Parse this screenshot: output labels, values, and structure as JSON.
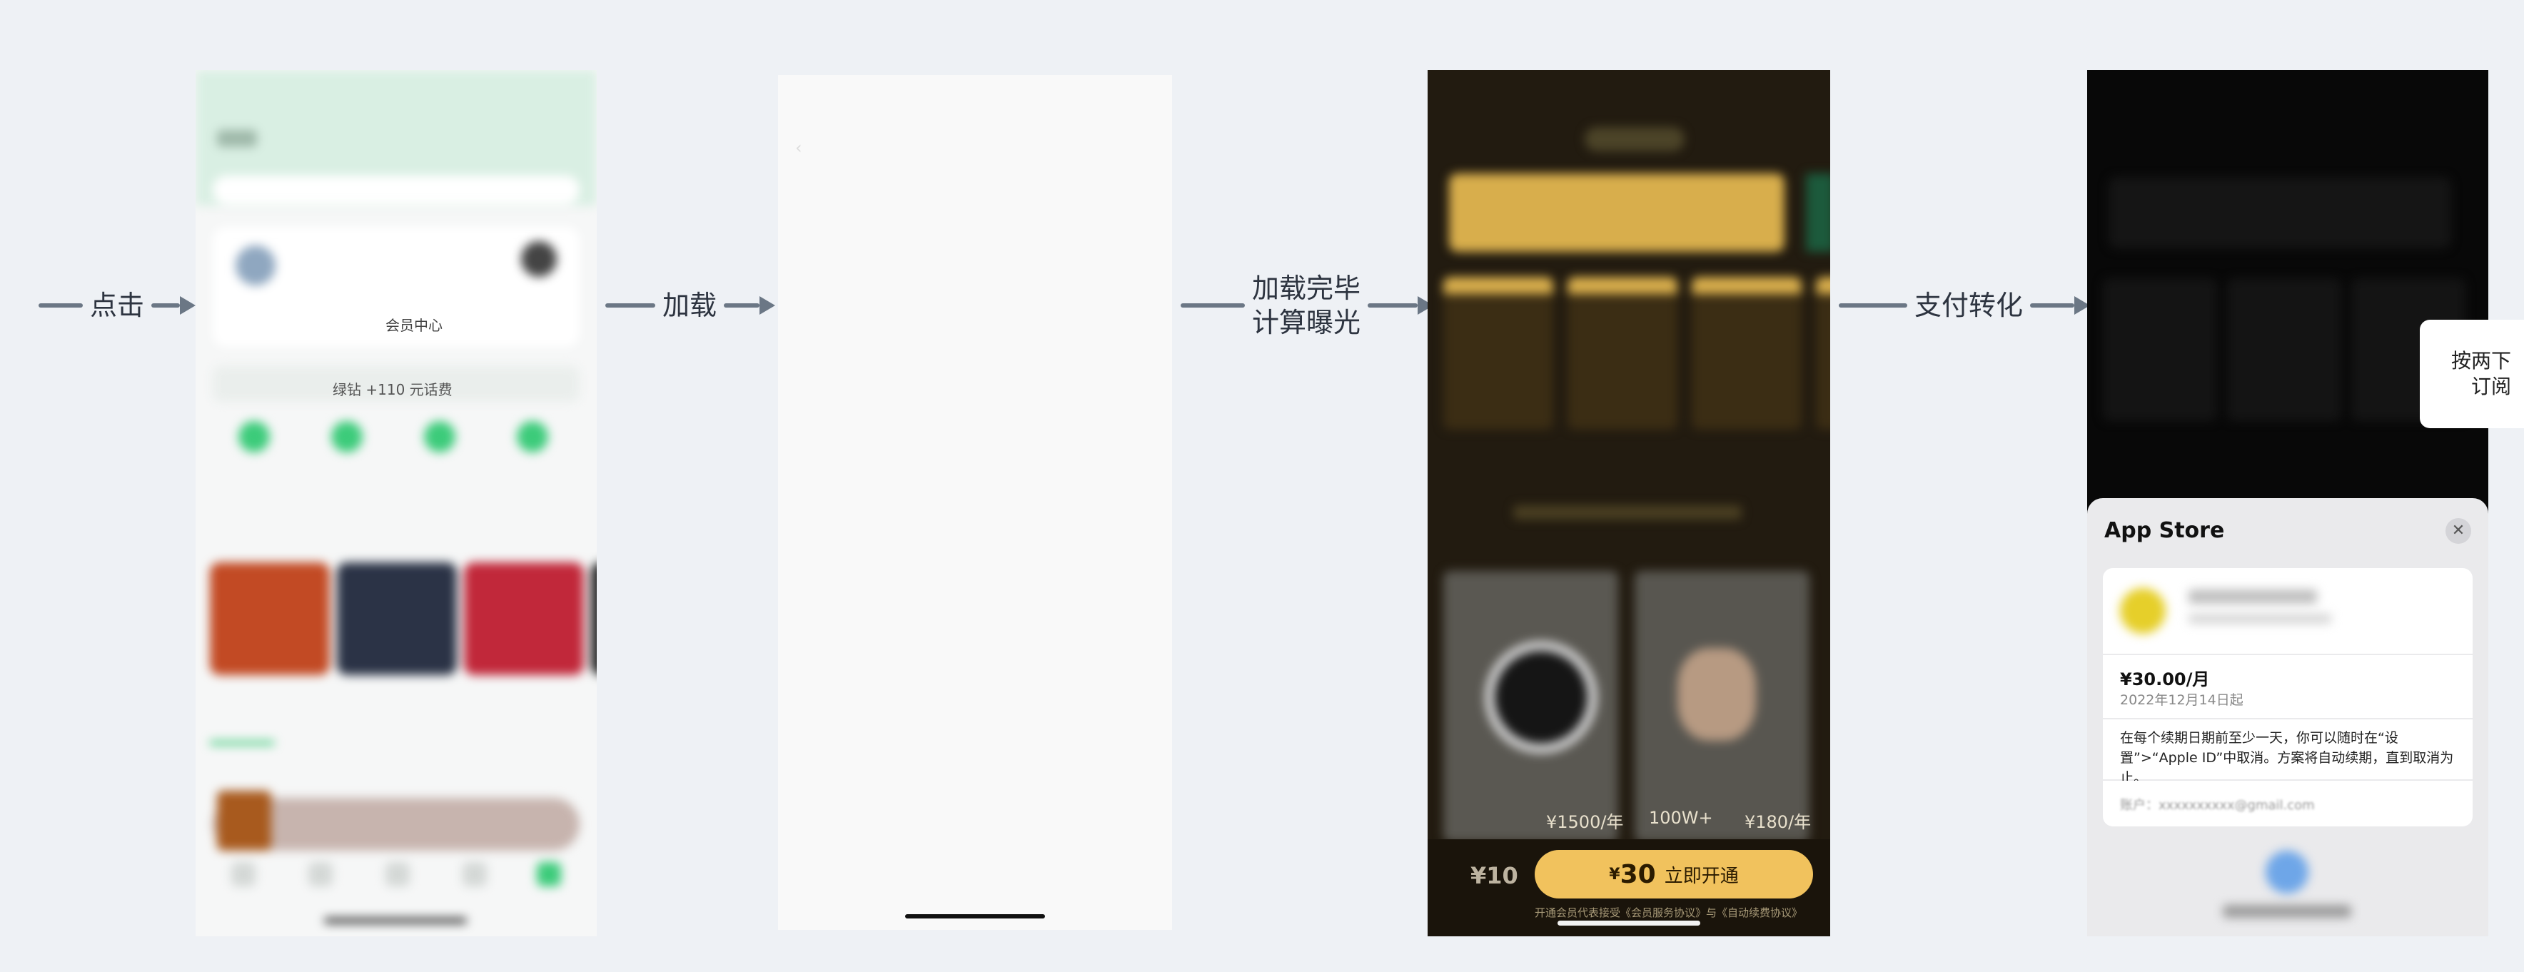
{
  "flow": {
    "step1_label": "点击",
    "step2_label": "加载",
    "step3_label_line1": "加载完毕",
    "step3_label_line2": "计算曝光",
    "step4_label": "支付转化"
  },
  "phone1": {
    "membercenter_label": "会员中心",
    "promo_text": "绿钻 +110 元话费"
  },
  "phone3": {
    "price_per_year_1": "¥1500/年",
    "price_per_year_2": "¥180/年",
    "members_count": "100W+",
    "price_left": "¥10",
    "pay_currency": "¥",
    "pay_amount": "30",
    "pay_label": "立即开通",
    "agreement": "开通会员代表接受《会员服务协议》与《自动续费协议》"
  },
  "phone4": {
    "sheet_title": "App Store",
    "price": "¥30.00/月",
    "start_date": "2022年12月14日起",
    "note": "在每个续期日期前至少一天，你可以随时在“设置”>“Apple ID”中取消。方案将自动续期，直到取消为止。",
    "account": "账户：xxxxxxxxxx@gmail.com",
    "side_hint": "按两下\n订阅"
  }
}
